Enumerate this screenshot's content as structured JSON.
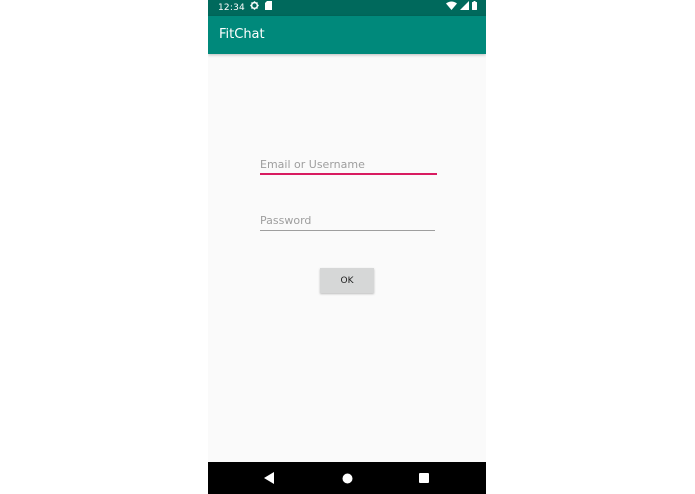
{
  "status_bar": {
    "time": "12:34",
    "icons": [
      "gear-icon",
      "sd-card-icon",
      "wifi-icon",
      "signal-icon",
      "battery-icon"
    ]
  },
  "app_bar": {
    "title": "FitChat"
  },
  "login_form": {
    "email_placeholder": "Email or Username",
    "email_value": "",
    "password_placeholder": "Password",
    "password_value": "",
    "ok_label": "OK"
  },
  "nav_bar": {
    "icons": [
      "back-icon",
      "home-icon",
      "recents-icon"
    ]
  },
  "colors": {
    "status_bar": "#00695c",
    "app_bar": "#00897b",
    "accent": "#d81b60",
    "background": "#fafafa",
    "button": "#d6d7d7"
  }
}
